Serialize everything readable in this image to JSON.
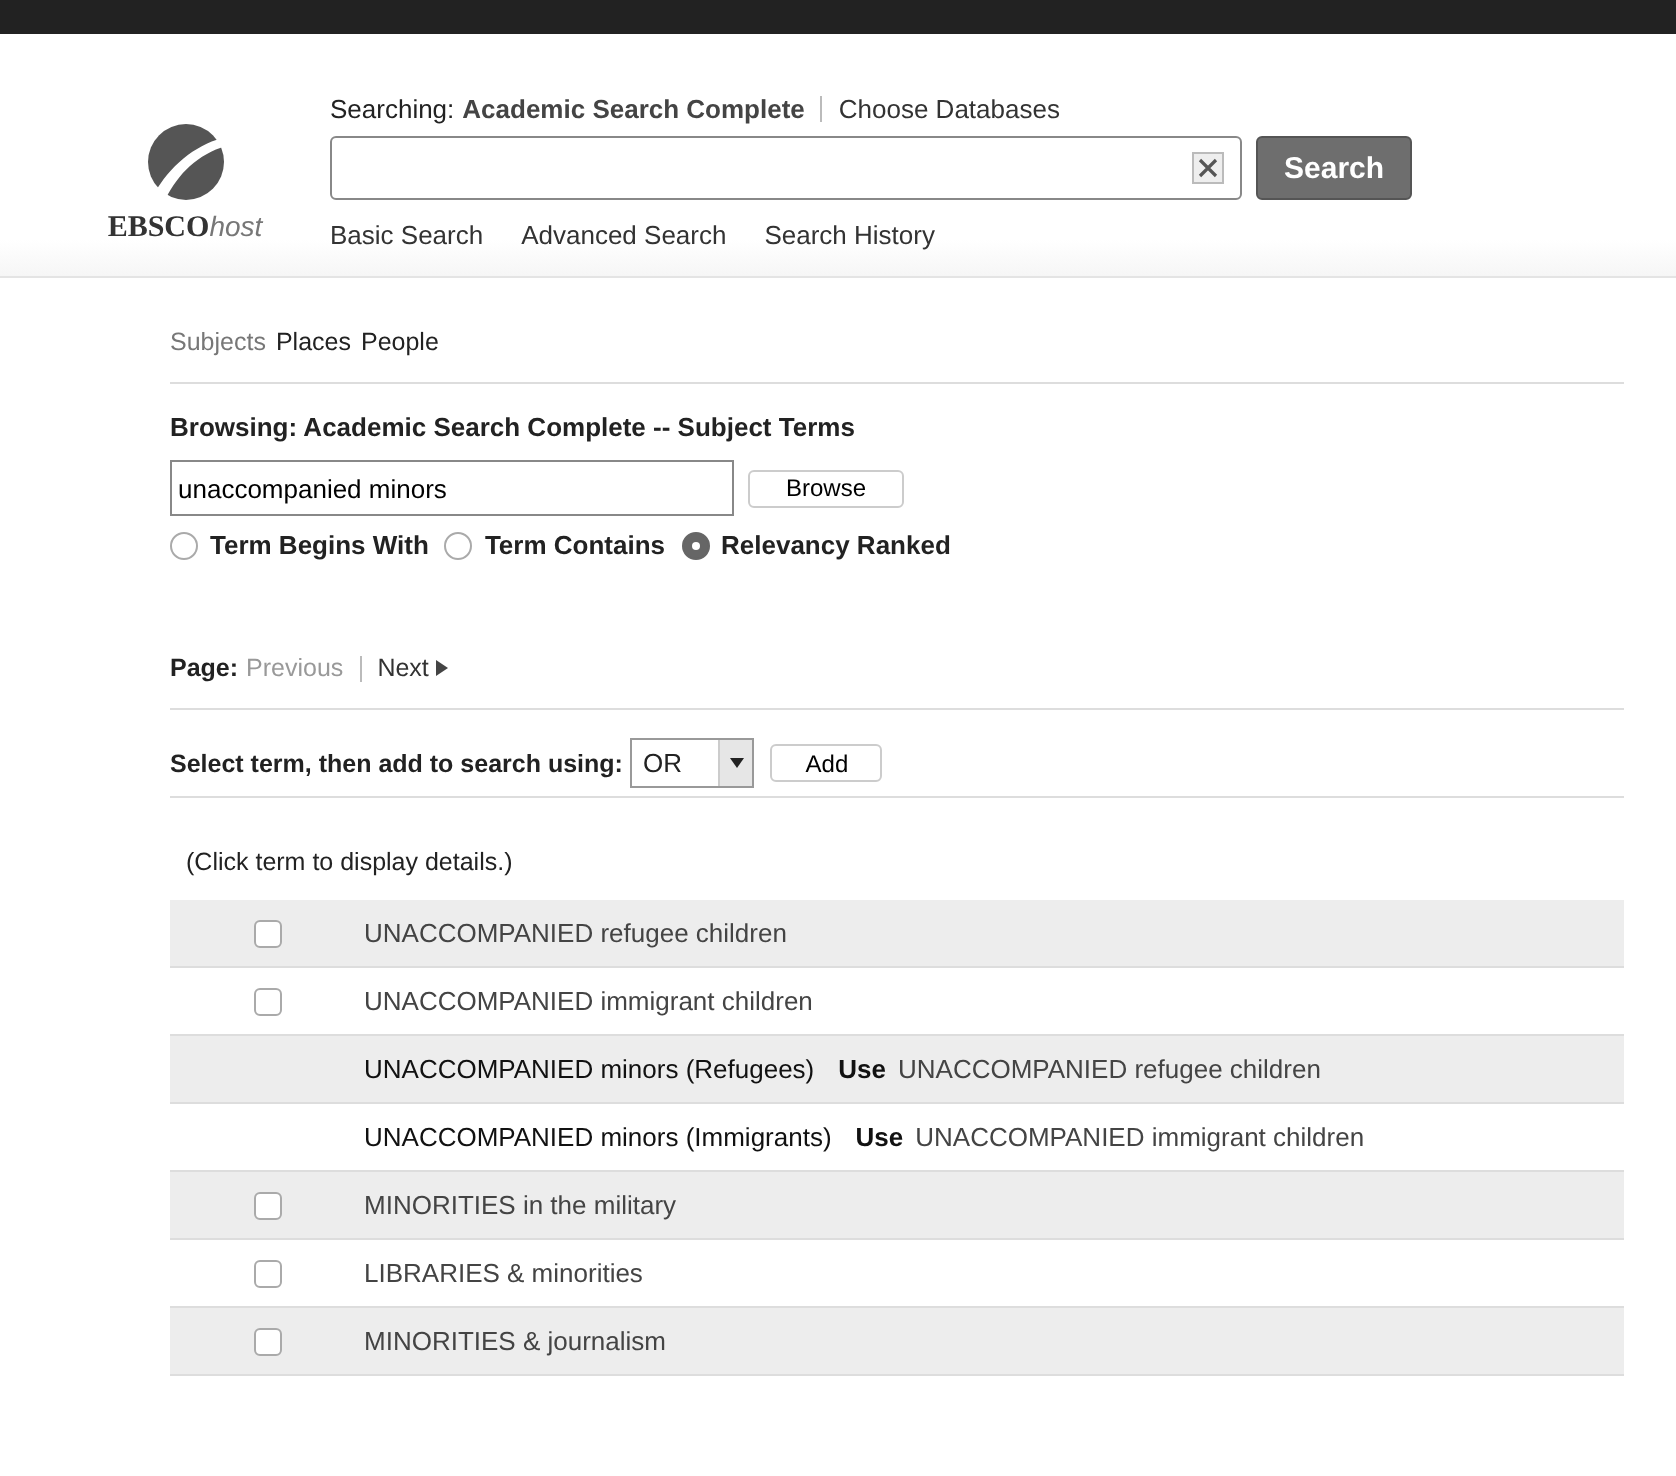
{
  "header": {
    "logo": {
      "brand": "EBSCO",
      "suffix": "host"
    },
    "searching_label": "Searching:",
    "database": "Academic Search Complete",
    "choose_link": "Choose Databases",
    "search_button": "Search",
    "nav_links": [
      "Basic Search",
      "Advanced Search",
      "Search History"
    ]
  },
  "browse_tabs": [
    {
      "label": "Subjects",
      "selected": true
    },
    {
      "label": "Places",
      "selected": false
    },
    {
      "label": "People",
      "selected": false
    }
  ],
  "browsing_title": "Browsing: Academic Search Complete -- Subject Terms",
  "browse_field": {
    "value": "unaccompanied minors"
  },
  "browse_button": "Browse",
  "options": [
    {
      "label": "Term Begins With",
      "selected": false
    },
    {
      "label": "Term Contains",
      "selected": false
    },
    {
      "label": "Relevancy Ranked",
      "selected": true
    }
  ],
  "pager": {
    "label": "Page:",
    "previous": {
      "label": "Previous",
      "disabled": true
    },
    "next": {
      "label": "Next",
      "disabled": false
    }
  },
  "add_bar": {
    "label": "Select term, then add to search using:",
    "operator": "OR",
    "button": "Add"
  },
  "hint": "(Click term to display details.)",
  "terms": [
    {
      "kind": "term",
      "text": "UNACCOMPANIED refugee children",
      "checked": false
    },
    {
      "kind": "term",
      "text": "UNACCOMPANIED immigrant children",
      "checked": false
    },
    {
      "kind": "see",
      "text": "UNACCOMPANIED minors (Refugees)",
      "use": "Use",
      "target": "UNACCOMPANIED refugee children"
    },
    {
      "kind": "see",
      "text": "UNACCOMPANIED minors (Immigrants)",
      "use": "Use",
      "target": "UNACCOMPANIED immigrant children"
    },
    {
      "kind": "term",
      "text": "MINORITIES in the military",
      "checked": false
    },
    {
      "kind": "term",
      "text": "LIBRARIES & minorities",
      "checked": false
    },
    {
      "kind": "term",
      "text": "MINORITIES & journalism",
      "checked": false
    }
  ]
}
